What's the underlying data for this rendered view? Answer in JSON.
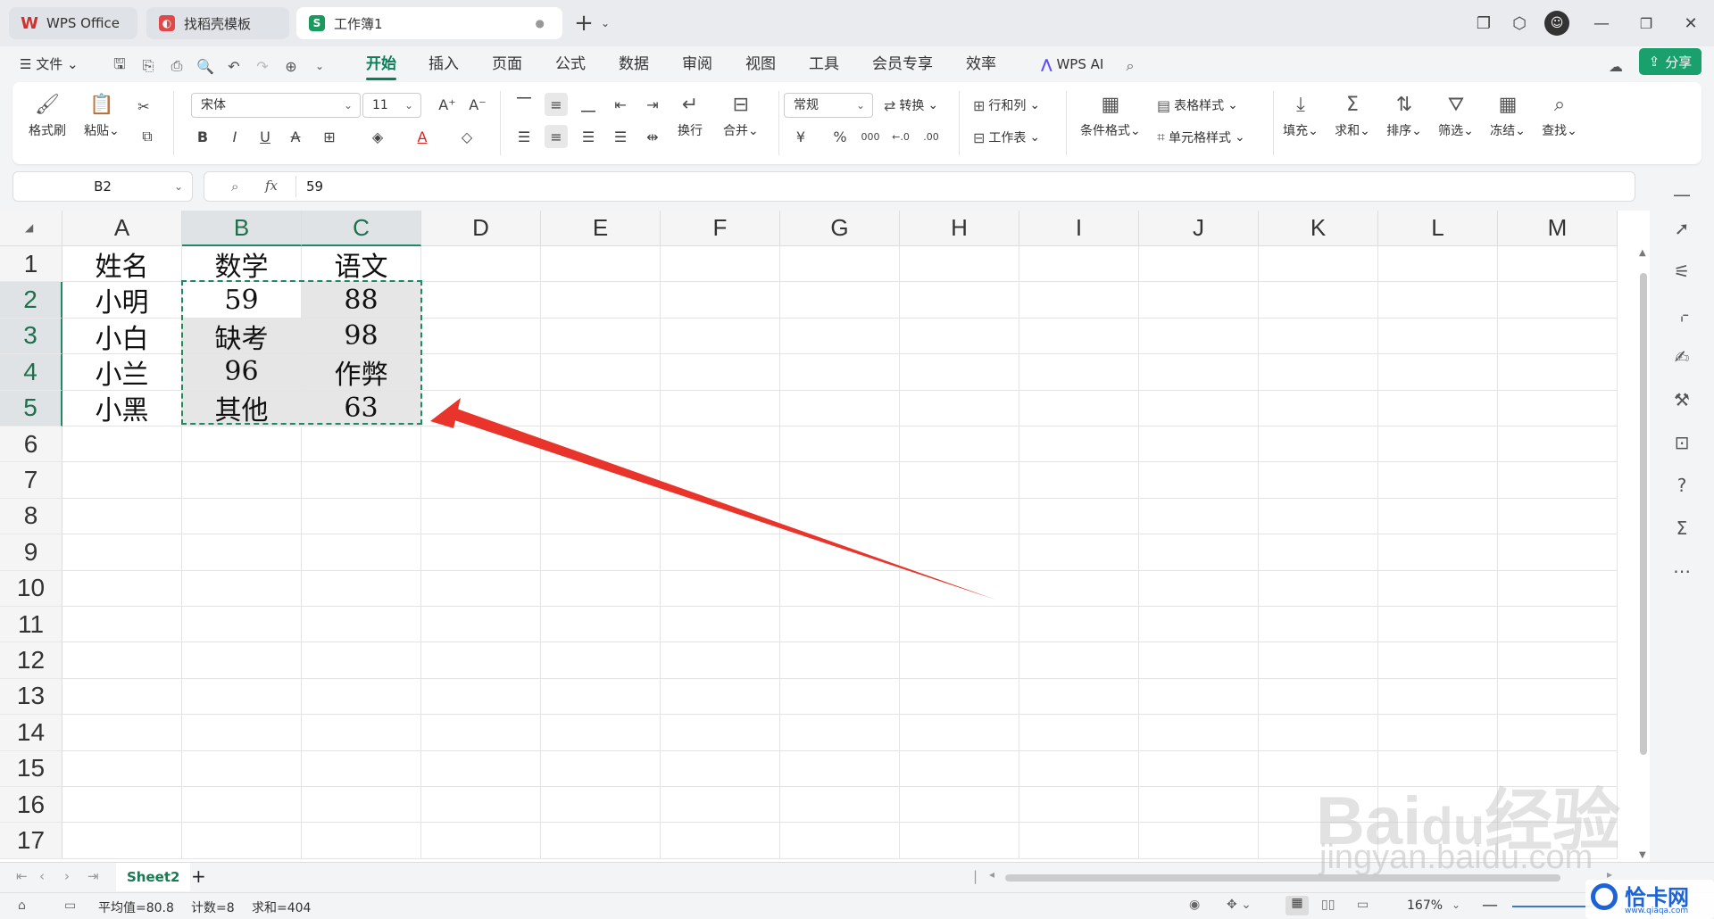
{
  "titlebar": {
    "tabs": [
      {
        "label": "WPS Office",
        "icon": "wps-logo-icon",
        "color": "#d0302e"
      },
      {
        "label": "找稻壳模板",
        "icon": "docer-icon",
        "color": "#e0494a"
      },
      {
        "label": "工作簿1",
        "icon": "spreadsheet-icon",
        "color": "#1a9a5e"
      }
    ],
    "new_tab": "+"
  },
  "menu": {
    "file": "文件",
    "tabs": [
      "开始",
      "插入",
      "页面",
      "公式",
      "数据",
      "审阅",
      "视图",
      "工具",
      "会员专享",
      "效率"
    ],
    "active_tab": "开始",
    "wps_ai": "WPS AI",
    "share": "分享"
  },
  "ribbon": {
    "format_painter": "格式刷",
    "paste": "粘贴",
    "font_name": "宋体",
    "font_size": "11",
    "wrap": "换行",
    "merge": "合并",
    "number_format": "常规",
    "convert": "转换",
    "row_col": "行和列",
    "worksheet": "工作表",
    "cond_format": "条件格式",
    "table_style": "表格样式",
    "cell_style": "单元格样式",
    "fill": "填充",
    "sum": "求和",
    "sort": "排序",
    "filter": "筛选",
    "freeze": "冻结",
    "find": "查找"
  },
  "formula_bar": {
    "name_box": "B2",
    "fx": "fx",
    "value": "59"
  },
  "grid": {
    "columns": [
      "A",
      "B",
      "C",
      "D",
      "E",
      "F",
      "G",
      "H",
      "I",
      "J",
      "K",
      "L",
      "M"
    ],
    "rows": [
      "1",
      "2",
      "3",
      "4",
      "5",
      "6",
      "7",
      "8",
      "9",
      "10",
      "11",
      "12",
      "13",
      "14",
      "15",
      "16",
      "17"
    ],
    "cells": [
      [
        "姓名",
        "数学",
        "语文"
      ],
      [
        "小明",
        "59",
        "88"
      ],
      [
        "小白",
        "缺考",
        "98"
      ],
      [
        "小兰",
        "96",
        "作弊"
      ],
      [
        "小黑",
        "其他",
        "63"
      ]
    ],
    "selected_range": "B2:C5",
    "accent": "#1f8a5f",
    "arrow_color": "#e8342a"
  },
  "sheets": {
    "tabs": [
      "Sheet2"
    ],
    "add": "+"
  },
  "status": {
    "average": "平均值=80.8",
    "count": "计数=8",
    "sum": "求和=404",
    "zoom": "167%"
  },
  "watermark": {
    "baidu": "Bai",
    "du": "du",
    "jingyan": "经验",
    "url": "jingyan.baidu.com",
    "site": "恰卡网",
    "site_url": "www.qiaqa.com"
  }
}
